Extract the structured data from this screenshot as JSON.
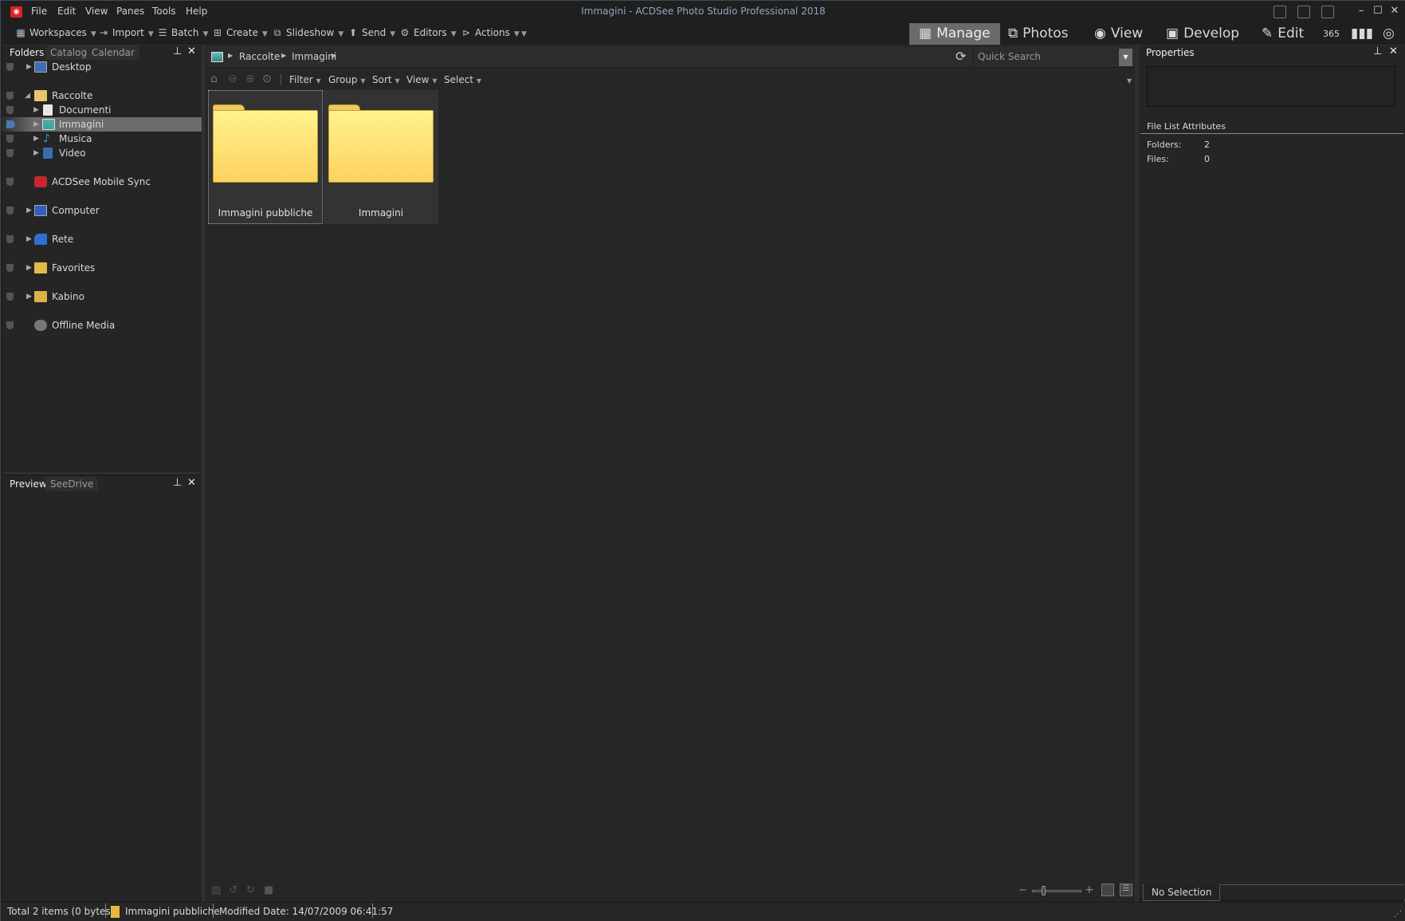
{
  "window": {
    "title": "Immagini - ACDSee Photo Studio Professional 2018",
    "app_icon": "acdsee-camera-icon"
  },
  "menu": [
    "File",
    "Edit",
    "View",
    "Panes",
    "Tools",
    "Help"
  ],
  "toolbar": [
    {
      "label": "Workspaces",
      "icon": "workspaces-icon"
    },
    {
      "label": "Import",
      "icon": "import-icon"
    },
    {
      "label": "Batch",
      "icon": "batch-icon"
    },
    {
      "label": "Create",
      "icon": "create-icon"
    },
    {
      "label": "Slideshow",
      "icon": "slideshow-icon"
    },
    {
      "label": "Send",
      "icon": "send-icon"
    },
    {
      "label": "Editors",
      "icon": "editors-icon"
    },
    {
      "label": "Actions",
      "icon": "actions-icon"
    }
  ],
  "modes": [
    {
      "label": "Manage",
      "icon": "grid-icon",
      "active": true
    },
    {
      "label": "Photos",
      "icon": "photos-icon"
    },
    {
      "label": "View",
      "icon": "eye-icon"
    },
    {
      "label": "Develop",
      "icon": "develop-icon"
    },
    {
      "label": "Edit",
      "icon": "edit-icon"
    }
  ],
  "mode_icons": [
    "365-icon",
    "dashboard-icon",
    "privacy-icon"
  ],
  "folders_panel": {
    "tabs": [
      "Folders",
      "Catalog",
      "Calendar"
    ],
    "active_tab": "Folders",
    "tree": [
      {
        "label": "Desktop",
        "expandable": true,
        "level": 0
      },
      {
        "label": "Raccolte",
        "expanded": true,
        "level": 0
      },
      {
        "label": "Documenti",
        "expandable": true,
        "level": 1
      },
      {
        "label": "Immagini",
        "expandable": true,
        "level": 1,
        "selected": true
      },
      {
        "label": "Musica",
        "expandable": true,
        "level": 1
      },
      {
        "label": "Video",
        "expandable": true,
        "level": 1
      },
      {
        "label": "ACDSee Mobile Sync",
        "level": 0
      },
      {
        "label": "Computer",
        "expandable": true,
        "level": 0
      },
      {
        "label": "Rete",
        "expandable": true,
        "level": 0
      },
      {
        "label": "Favorites",
        "expandable": true,
        "level": 0
      },
      {
        "label": "Kabino",
        "expandable": true,
        "level": 0
      },
      {
        "label": "Offline Media",
        "level": 0
      }
    ]
  },
  "preview_panel": {
    "tabs": [
      "Preview",
      "SeeDrive"
    ],
    "active_tab": "Preview"
  },
  "address": {
    "breadcrumb": [
      "Raccolte",
      "Immagini"
    ],
    "search_placeholder": "Quick Search"
  },
  "nav": {
    "menus": [
      "Filter",
      "Group",
      "Sort",
      "View",
      "Select"
    ]
  },
  "files": [
    {
      "name": "Immagini pubbliche",
      "type": "folder",
      "focused": true
    },
    {
      "name": "Immagini",
      "type": "folder"
    }
  ],
  "properties": {
    "title": "Properties",
    "section": "File List Attributes",
    "rows": [
      {
        "label": "Folders:",
        "value": "2"
      },
      {
        "label": "Files:",
        "value": "0"
      }
    ],
    "footer_tab": "No Selection"
  },
  "status": {
    "total": "Total 2 items  (0 bytes)",
    "item": "Immagini pubbliche",
    "modified": "Modified Date: 14/07/2009 06:41:57"
  },
  "zoom_slider": {
    "value": 0.2
  }
}
